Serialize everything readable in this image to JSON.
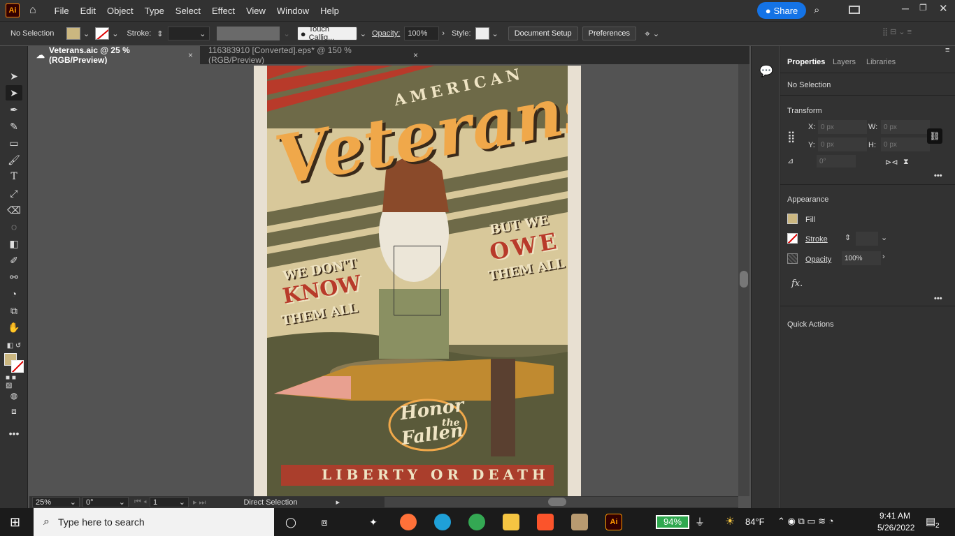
{
  "app": {
    "logo": "Ai",
    "menus": [
      "File",
      "Edit",
      "Object",
      "Type",
      "Select",
      "Effect",
      "View",
      "Window",
      "Help"
    ],
    "share_label": "Share"
  },
  "control": {
    "selection": "No Selection",
    "stroke_label": "Stroke:",
    "brush": "Touch Callig...",
    "opacity_label": "Opacity:",
    "opacity_value": "100%",
    "style_label": "Style:",
    "doc_setup": "Document Setup",
    "preferences": "Preferences"
  },
  "tabs": [
    {
      "label": "Veterans.aic @ 25 % (RGB/Preview)",
      "close": "×"
    },
    {
      "label": "116383910 [Converted].eps* @ 150 % (RGB/Preview)",
      "close": "×"
    }
  ],
  "poster": {
    "american": "AMERICAN",
    "veterans": "Veterans",
    "left1": "WE DON'T",
    "left2": "KNOW",
    "left3": "THEM ALL",
    "right1": "BUT WE",
    "right2": "OWE",
    "right3": "THEM ALL",
    "honor1": "Honor",
    "honor2": "the",
    "honor3": "Fallen",
    "banner": "LIBERTY OR DEATH",
    "colors": {
      "bg": "#6e6a48",
      "cream": "#efe4c4",
      "red": "#b83a2a",
      "orange": "#f0a84a",
      "dark": "#3a2a1a"
    }
  },
  "status": {
    "zoom": "25%",
    "rotation": "0°",
    "artboard": "1",
    "tool": "Direct Selection"
  },
  "panel": {
    "tabs": [
      "Properties",
      "Layers",
      "Libraries"
    ],
    "selection": "No Selection",
    "transform": "Transform",
    "x_label": "X:",
    "y_label": "Y:",
    "w_label": "W:",
    "h_label": "H:",
    "px_placeholder": "0 px",
    "angle_placeholder": "0°",
    "appearance": "Appearance",
    "fill": "Fill",
    "stroke": "Stroke",
    "opacity": "Opacity",
    "opacity_value": "100%",
    "fx": "fx.",
    "quick_actions": "Quick Actions"
  },
  "taskbar": {
    "search_placeholder": "Type here to search",
    "battery": "94%",
    "weather": "84°F",
    "time": "9:41 AM",
    "date": "5/26/2022",
    "notifications": "2"
  }
}
